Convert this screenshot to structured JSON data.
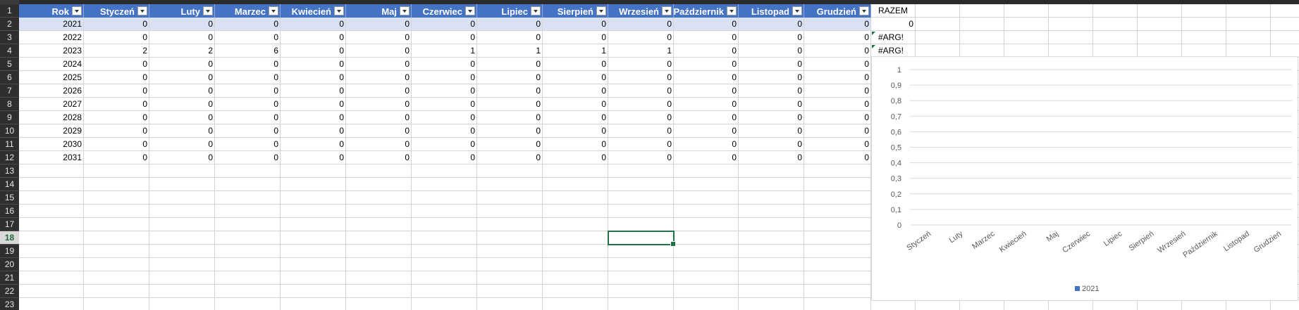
{
  "table": {
    "headers": [
      "Rok",
      "Styczeń",
      "Luty",
      "Marzec",
      "Kwiecień",
      "Maj",
      "Czerwiec",
      "Lipiec",
      "Sierpień",
      "Wrzesień",
      "Październik",
      "Listopad",
      "Grudzień"
    ],
    "rows": [
      [
        "2021",
        "0",
        "0",
        "0",
        "0",
        "0",
        "0",
        "0",
        "0",
        "0",
        "0",
        "0",
        "0"
      ],
      [
        "2022",
        "0",
        "0",
        "0",
        "0",
        "0",
        "0",
        "0",
        "0",
        "0",
        "0",
        "0",
        "0"
      ],
      [
        "2023",
        "2",
        "2",
        "6",
        "0",
        "0",
        "1",
        "1",
        "1",
        "1",
        "0",
        "0",
        "0"
      ],
      [
        "2024",
        "0",
        "0",
        "0",
        "0",
        "0",
        "0",
        "0",
        "0",
        "0",
        "0",
        "0",
        "0"
      ],
      [
        "2025",
        "0",
        "0",
        "0",
        "0",
        "0",
        "0",
        "0",
        "0",
        "0",
        "0",
        "0",
        "0"
      ],
      [
        "2026",
        "0",
        "0",
        "0",
        "0",
        "0",
        "0",
        "0",
        "0",
        "0",
        "0",
        "0",
        "0"
      ],
      [
        "2027",
        "0",
        "0",
        "0",
        "0",
        "0",
        "0",
        "0",
        "0",
        "0",
        "0",
        "0",
        "0"
      ],
      [
        "2028",
        "0",
        "0",
        "0",
        "0",
        "0",
        "0",
        "0",
        "0",
        "0",
        "0",
        "0",
        "0"
      ],
      [
        "2029",
        "0",
        "0",
        "0",
        "0",
        "0",
        "0",
        "0",
        "0",
        "0",
        "0",
        "0",
        "0"
      ],
      [
        "2030",
        "0",
        "0",
        "0",
        "0",
        "0",
        "0",
        "0",
        "0",
        "0",
        "0",
        "0",
        "0"
      ],
      [
        "2031",
        "0",
        "0",
        "0",
        "0",
        "0",
        "0",
        "0",
        "0",
        "0",
        "0",
        "0",
        "0"
      ]
    ]
  },
  "row_numbers": [
    "1",
    "2",
    "3",
    "4",
    "5",
    "6",
    "7",
    "8",
    "9",
    "10",
    "11",
    "12",
    "13",
    "14",
    "15",
    "16",
    "17",
    "18",
    "19",
    "20",
    "21",
    "22",
    "23"
  ],
  "razem": {
    "label": "RAZEM",
    "values": [
      "0",
      "#ARG!",
      "#ARG!"
    ]
  },
  "chart_data": {
    "type": "bar",
    "categories": [
      "Styczeń",
      "Luty",
      "Marzec",
      "Kwiecień",
      "Maj",
      "Czerwiec",
      "Lipiec",
      "Sierpień",
      "Wrzesień",
      "Październik",
      "Listopad",
      "Grudzień"
    ],
    "series": [
      {
        "name": "2021",
        "values": [
          0,
          0,
          0,
          0,
          0,
          0,
          0,
          0,
          0,
          0,
          0,
          0
        ],
        "color": "#4472c4"
      }
    ],
    "yticks": [
      "0",
      "0,1",
      "0,2",
      "0,3",
      "0,4",
      "0,5",
      "0,6",
      "0,7",
      "0,8",
      "0,9",
      "1"
    ],
    "ylim": [
      0,
      1
    ],
    "grid": true,
    "legend": "bottom"
  },
  "colors": {
    "header_fill": "#4472c4",
    "band_fill": "#d9e1f2",
    "selection": "#217346"
  }
}
